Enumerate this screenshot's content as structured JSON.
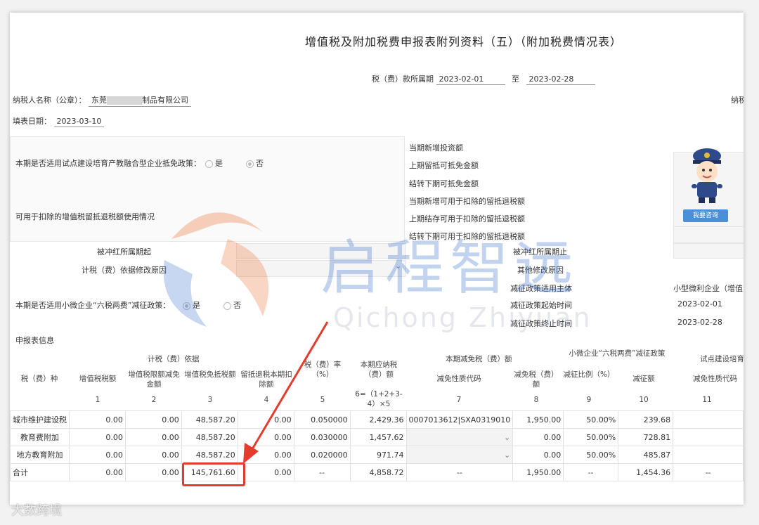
{
  "header": {
    "title": "增值税及附加税费申报表附列资料（五）（附加税费情况表）",
    "period_label": "税（费）款所属期",
    "period_from": "2023-02-01",
    "period_to_sep": "至",
    "period_to": "2023-02-28",
    "taxpayer_label": "纳税人名称（公章）：",
    "taxpayer_prefix": "东莞",
    "taxpayer_suffix": "制品有限公司",
    "right_cut_label": "纳税",
    "fill_date_label": "填表日期：",
    "fill_date": "2023-03-10"
  },
  "section1": {
    "pilot_question": "本期是否适用试点建设培育产教融合型企业抵免政策：",
    "yes": "是",
    "no": "否",
    "right_labels": [
      "当期新增投资额",
      "上期留抵可抵免金额",
      "结转下期可抵免金额",
      "当期新增可用于扣除的留抵退税额",
      "上期结存可用于扣除的留抵退税额",
      "结转下期可用于扣除的留抵退税额"
    ],
    "refund_usage_label": "可用于扣除的增值税留抵退税额使用情况",
    "red_start_label": "被冲红所属期起",
    "red_end_label": "被冲红所属期止",
    "basis_reason_label": "计税（费）依据修改原因",
    "other_reason_label": "其他修改原因",
    "small_question": "本期是否适用小微企业“六税两费”减征政策：",
    "reduction_subject_label": "减征政策适用主体",
    "reduction_subject_value": "小型微利企业（增值",
    "reduction_start_label": "减征政策起始时间",
    "reduction_start_value": "2023-02-01",
    "reduction_end_label": "减征政策终止时间",
    "reduction_end_value": "2023-02-28",
    "consult_button": "我要咨询"
  },
  "table": {
    "section_label": "申报表信息",
    "group_basis": "计税（费）依据",
    "group_reduction": "本期减免税（费）额",
    "group_small": "小微企业“六税两费”减征政策",
    "group_pilot": "试点建设培育",
    "headers": [
      "税（费）种",
      "增值税税额",
      "增值税限额减免金额",
      "增值税免抵税额",
      "留抵退税本期扣除额",
      "税（费）率（%）",
      "本期应纳税（费）额",
      "减免性质代码",
      "减免税（费）额",
      "减征比例（%）",
      "减征额",
      "减免性质代码"
    ],
    "col_nums": [
      "",
      "1",
      "2",
      "3",
      "4",
      "5",
      "6=（1+2+3-4）×5",
      "7",
      "8",
      "9",
      "10",
      "11"
    ],
    "rows": [
      {
        "name": "城市维护建设税",
        "c1": "0.00",
        "c2": "0.00",
        "c3": "48,587.20",
        "c4": "0.00",
        "c5": "0.050000",
        "c6": "2,429.36",
        "c7": "0007013612|SXA0319010",
        "c8": "1,950.00",
        "c9": "50.00%",
        "c10": "239.68",
        "c11": ""
      },
      {
        "name": "教育费附加",
        "c1": "0.00",
        "c2": "0.00",
        "c3": "48,587.20",
        "c4": "0.00",
        "c5": "0.030000",
        "c6": "1,457.62",
        "c7": "",
        "c8": "0.00",
        "c9": "50.00%",
        "c10": "728.81",
        "c11": ""
      },
      {
        "name": "地方教育附加",
        "c1": "0.00",
        "c2": "0.00",
        "c3": "48,587.20",
        "c4": "0.00",
        "c5": "0.020000",
        "c6": "971.74",
        "c7": "",
        "c8": "0.00",
        "c9": "50.00%",
        "c10": "485.87",
        "c11": ""
      },
      {
        "name": "合计",
        "c1": "0.00",
        "c2": "0.00",
        "c3": "145,761.60",
        "c4": "0.00",
        "c5": "--",
        "c6": "4,858.72",
        "c7": "--",
        "c8": "1,950.00",
        "c9": "--",
        "c10": "1,454.36",
        "c11": "--"
      }
    ]
  },
  "watermark": {
    "main": "启程智远",
    "pinyin": "Qichong Zhiyuan"
  },
  "credit": "大数跨境",
  "colors": {
    "highlight": "#e43b2f",
    "watermark": "#4678d2",
    "button": "#4a90d9"
  }
}
